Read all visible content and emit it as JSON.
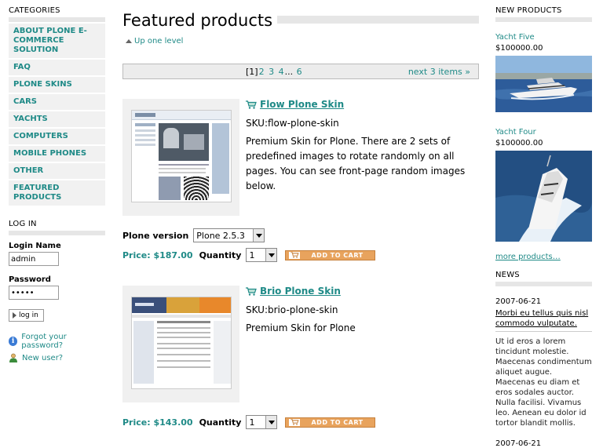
{
  "left": {
    "categories_header": "CATEGORIES",
    "categories": [
      "ABOUT PLONE E-COMMERCE SOLUTION",
      "FAQ",
      "PLONE SKINS",
      "CARS",
      "YACHTS",
      "COMPUTERS",
      "MOBILE PHONES",
      "OTHER",
      "FEATURED PRODUCTS"
    ],
    "login_header": "LOG IN",
    "login_name_label": "Login Name",
    "login_name_value": "admin",
    "password_label": "Password",
    "password_value": "•••••",
    "login_button": "log in",
    "forgot_password": "Forgot your password?",
    "new_user": "New user?"
  },
  "main": {
    "title": "Featured products",
    "up_one_level": "Up one level",
    "pager": {
      "current": "[1]",
      "pages": [
        "2",
        "3",
        "4"
      ],
      "ellipsis": "...",
      "last": "6",
      "next": "next 3 items »"
    },
    "products": [
      {
        "name": "Flow Plone Skin",
        "sku": "SKU:flow-plone-skin",
        "description": "Premium Skin for Plone. There are 2 sets of predefined images to rotate randomly on all pages. You can see front-page random images below.",
        "option_label": "Plone version",
        "option_value": "Plone 2.5.3",
        "price": "Price: $187.00",
        "quantity_label": "Quantity",
        "quantity_value": "1",
        "add_to_cart": "ADD TO CART"
      },
      {
        "name": "Brio Plone Skin",
        "sku": "SKU:brio-plone-skin",
        "description": "Premium Skin for Plone",
        "price": "Price: $143.00",
        "quantity_label": "Quantity",
        "quantity_value": "1",
        "add_to_cart": "ADD TO CART"
      }
    ]
  },
  "right": {
    "new_products_header": "NEW PRODUCTS",
    "new_products": [
      {
        "name": "Yacht Five",
        "price": "$100000.00"
      },
      {
        "name": "Yacht Four",
        "price": "$100000.00"
      }
    ],
    "more_products": "more products…",
    "news_header": "NEWS",
    "news": [
      {
        "date": "2007-06-21",
        "title": "Morbi eu tellus quis nisl commodo vulputate.",
        "body": "Ut id eros a lorem tincidunt molestie. Maecenas condimentum aliquet augue. Maecenas eu diam et eros sodales auctor. Nulla facilisi. Vivamus leo. Aenean eu dolor id tortor blandit mollis."
      },
      {
        "date": "2007-06-21"
      }
    ]
  },
  "colors": {
    "link": "#1f8a87",
    "portlet_bar": "#e6e6e6",
    "cart_button": "#e8a35d"
  }
}
